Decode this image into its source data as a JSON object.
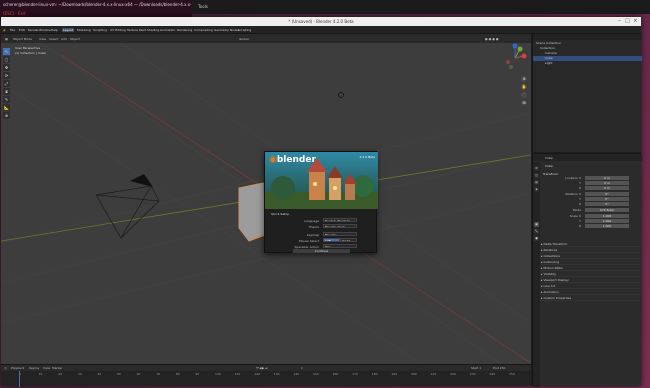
{
  "terminal": {
    "line1": "scherer@blender-linux-vm: ~/Downloads/blender-4.x.x-linux-x64 — /Downloads/blender-4.x.x-linux-x64",
    "line2": "(ESC) - Exit"
  },
  "panel_label": "Tools",
  "window": {
    "title": "* (Unsaved) - Blender 4.2.0 Beta",
    "min": "–",
    "max": "□",
    "close": "×"
  },
  "menu": [
    "File",
    "Edit",
    "Render",
    "Window",
    "Help"
  ],
  "workspaces": [
    "Layout",
    "Modeling",
    "Sculpting",
    "UV Editing",
    "Texture Paint",
    "Shading",
    "Animation",
    "Rendering",
    "Compositing",
    "Geometry Nodes",
    "Scripting"
  ],
  "header": {
    "mode": "Object Mode",
    "view": "View",
    "select": "Select",
    "add": "Add",
    "object": "Object",
    "orientation": "Global"
  },
  "overlay": {
    "line1": "User Perspective",
    "line2": "(1) Collection | Cube"
  },
  "tools": [
    "↖",
    "▢",
    "✥",
    "⟳",
    "⤢",
    "⧈",
    "✎",
    "📐",
    "⊕"
  ],
  "gizmo": {
    "x": "X",
    "y": "Y",
    "z": "Z"
  },
  "nav": [
    "⊕",
    "✋",
    "🎥",
    "⊞"
  ],
  "splash": {
    "logo": "blender",
    "version": "4.2.0 Beta",
    "section": "Quick Setup",
    "rows": [
      {
        "label": "Language",
        "value": "English (English)"
      },
      {
        "label": "Theme",
        "value": "Blender Dark"
      },
      {
        "label": "Keymap",
        "value": "Blender"
      },
      {
        "label": "Mouse Select",
        "value": "Left"
      },
      {
        "label": "Spacebar Action",
        "value": "Play"
      }
    ],
    "mouse_alt": "Right",
    "continue": "Continue"
  },
  "timeline": {
    "playback": "Playback",
    "keying": "Keying",
    "view": "View",
    "marker": "Marker",
    "frame": "1",
    "start": "Start 1",
    "end": "End 250",
    "ticks": [
      "0",
      "10",
      "20",
      "30",
      "40",
      "50",
      "60",
      "70",
      "80",
      "90",
      "100",
      "110",
      "120",
      "130",
      "140",
      "150",
      "160",
      "170",
      "180",
      "190",
      "200",
      "210",
      "220",
      "230",
      "240",
      "250"
    ]
  },
  "outliner": {
    "items": [
      {
        "label": "Scene Collection"
      },
      {
        "label": "Collection"
      },
      {
        "label": "Camera"
      },
      {
        "label": "Cube"
      },
      {
        "label": "Light"
      }
    ]
  },
  "properties": {
    "object_name": "Cube",
    "object_tab": "Cube",
    "transform": "Transform",
    "fields": [
      {
        "label": "Location X",
        "value": "0 m"
      },
      {
        "label": "Y",
        "value": "0 m"
      },
      {
        "label": "Z",
        "value": "0 m"
      },
      {
        "label": "Rotation X",
        "value": "0°"
      },
      {
        "label": "Y",
        "value": "0°"
      },
      {
        "label": "Z",
        "value": "0°"
      },
      {
        "label": "Mode",
        "value": "XYZ Euler"
      },
      {
        "label": "Scale X",
        "value": "1.000"
      },
      {
        "label": "Y",
        "value": "1.000"
      },
      {
        "label": "Z",
        "value": "1.000"
      }
    ],
    "panels": [
      "Delta Transform",
      "Relations",
      "Collections",
      "Instancing",
      "Motion Paths",
      "Visibility",
      "Viewport Display",
      "Line Art",
      "Animation",
      "Custom Properties"
    ]
  }
}
